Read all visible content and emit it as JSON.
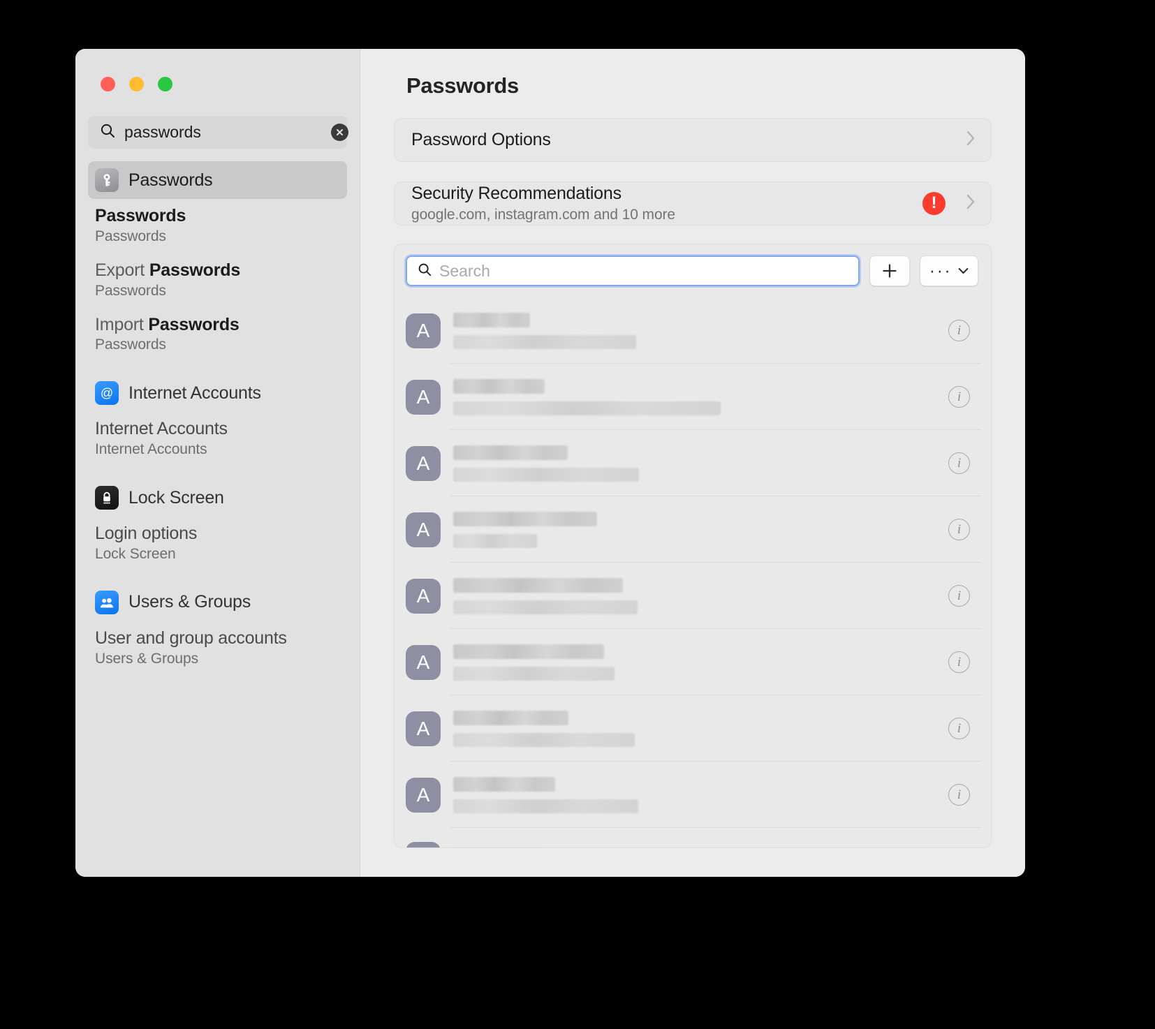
{
  "window": {
    "traffic_lights": [
      {
        "name": "close",
        "color": "#ff5f57"
      },
      {
        "name": "minimize",
        "color": "#febc2e"
      },
      {
        "name": "zoom",
        "color": "#28c840"
      }
    ]
  },
  "sidebar": {
    "search": {
      "value": "passwords",
      "placeholder": "Search",
      "clear_label": "Clear"
    },
    "groups": [
      {
        "header": {
          "label": "Passwords",
          "icon": "key-icon",
          "selected": true
        },
        "results": [
          {
            "title": "Passwords",
            "prefix": "",
            "subtitle": "Passwords",
            "bold": true
          },
          {
            "title": "Passwords",
            "prefix": "Export ",
            "subtitle": "Passwords",
            "bold": true
          },
          {
            "title": "Passwords",
            "prefix": "Import ",
            "subtitle": "Passwords",
            "bold": true
          }
        ]
      },
      {
        "header": {
          "label": "Internet Accounts",
          "icon": "at-sign-icon",
          "selected": false
        },
        "results": [
          {
            "title": "Internet Accounts",
            "prefix": "",
            "subtitle": "Internet Accounts",
            "bold": false
          }
        ]
      },
      {
        "header": {
          "label": "Lock Screen",
          "icon": "lock-icon",
          "selected": false
        },
        "results": [
          {
            "title": "Login options",
            "prefix": "",
            "subtitle": "Lock Screen",
            "bold": false
          }
        ]
      },
      {
        "header": {
          "label": "Users & Groups",
          "icon": "users-icon",
          "selected": false
        },
        "results": [
          {
            "title": "User and group accounts",
            "prefix": "",
            "subtitle": "Users & Groups",
            "bold": false
          }
        ]
      }
    ]
  },
  "main": {
    "title": "Passwords",
    "password_options": {
      "label": "Password Options",
      "chevron": "chevron-right-icon"
    },
    "security_recommendations": {
      "title": "Security Recommendations",
      "subtitle": "google.com, instagram.com and 10 more",
      "badge": "!",
      "badge_color": "#fc3b2d",
      "chevron": "chevron-right-icon"
    },
    "toolbar": {
      "search_placeholder": "Search",
      "search_value": "",
      "add_label": "+",
      "more_label": "···",
      "more_chevron": "chevron-down-icon",
      "focus_color": "#81a9ec"
    },
    "list": {
      "avatar_letter": "A",
      "info_label": "i",
      "rows": [
        {
          "title_w": 110,
          "sub_w": 262,
          "redacted": true
        },
        {
          "title_w": 131,
          "sub_w": 383,
          "redacted": true
        },
        {
          "title_w": 164,
          "sub_w": 266,
          "redacted": true
        },
        {
          "title_w": 206,
          "sub_w": 120,
          "redacted": true
        },
        {
          "title_w": 243,
          "sub_w": 264,
          "redacted": true
        },
        {
          "title_w": 216,
          "sub_w": 231,
          "redacted": true
        },
        {
          "title_w": 165,
          "sub_w": 260,
          "redacted": true
        },
        {
          "title_w": 146,
          "sub_w": 265,
          "redacted": true
        },
        {
          "title_w": 124,
          "sub_w": 0,
          "redacted": true
        }
      ]
    }
  }
}
